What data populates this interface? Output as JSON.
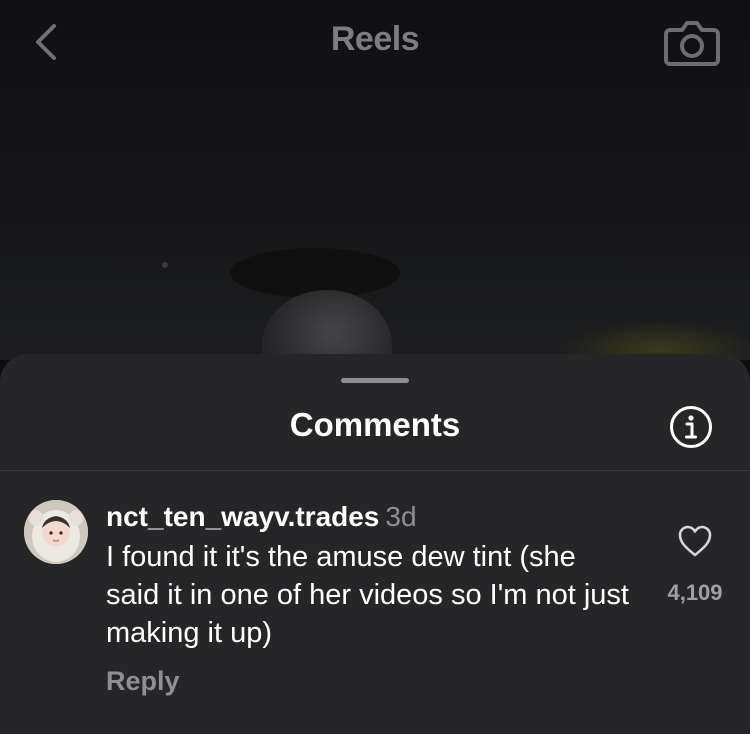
{
  "header": {
    "title": "Reels",
    "back_icon": "chevron-left-icon",
    "camera_icon": "camera-icon"
  },
  "comments_sheet": {
    "title": "Comments",
    "info_icon": "info-icon",
    "comments": [
      {
        "username": "nct_ten_wayv.trades",
        "time": "3d",
        "text": "I found it it's the amuse dew tint (she said it in one of her videos so I'm not just making it up)",
        "reply_label": "Reply",
        "like_count": "4,109"
      }
    ]
  },
  "colors": {
    "sheet_bg": "#262628",
    "muted_text": "#8e8e93",
    "primary_text": "#ffffff"
  }
}
